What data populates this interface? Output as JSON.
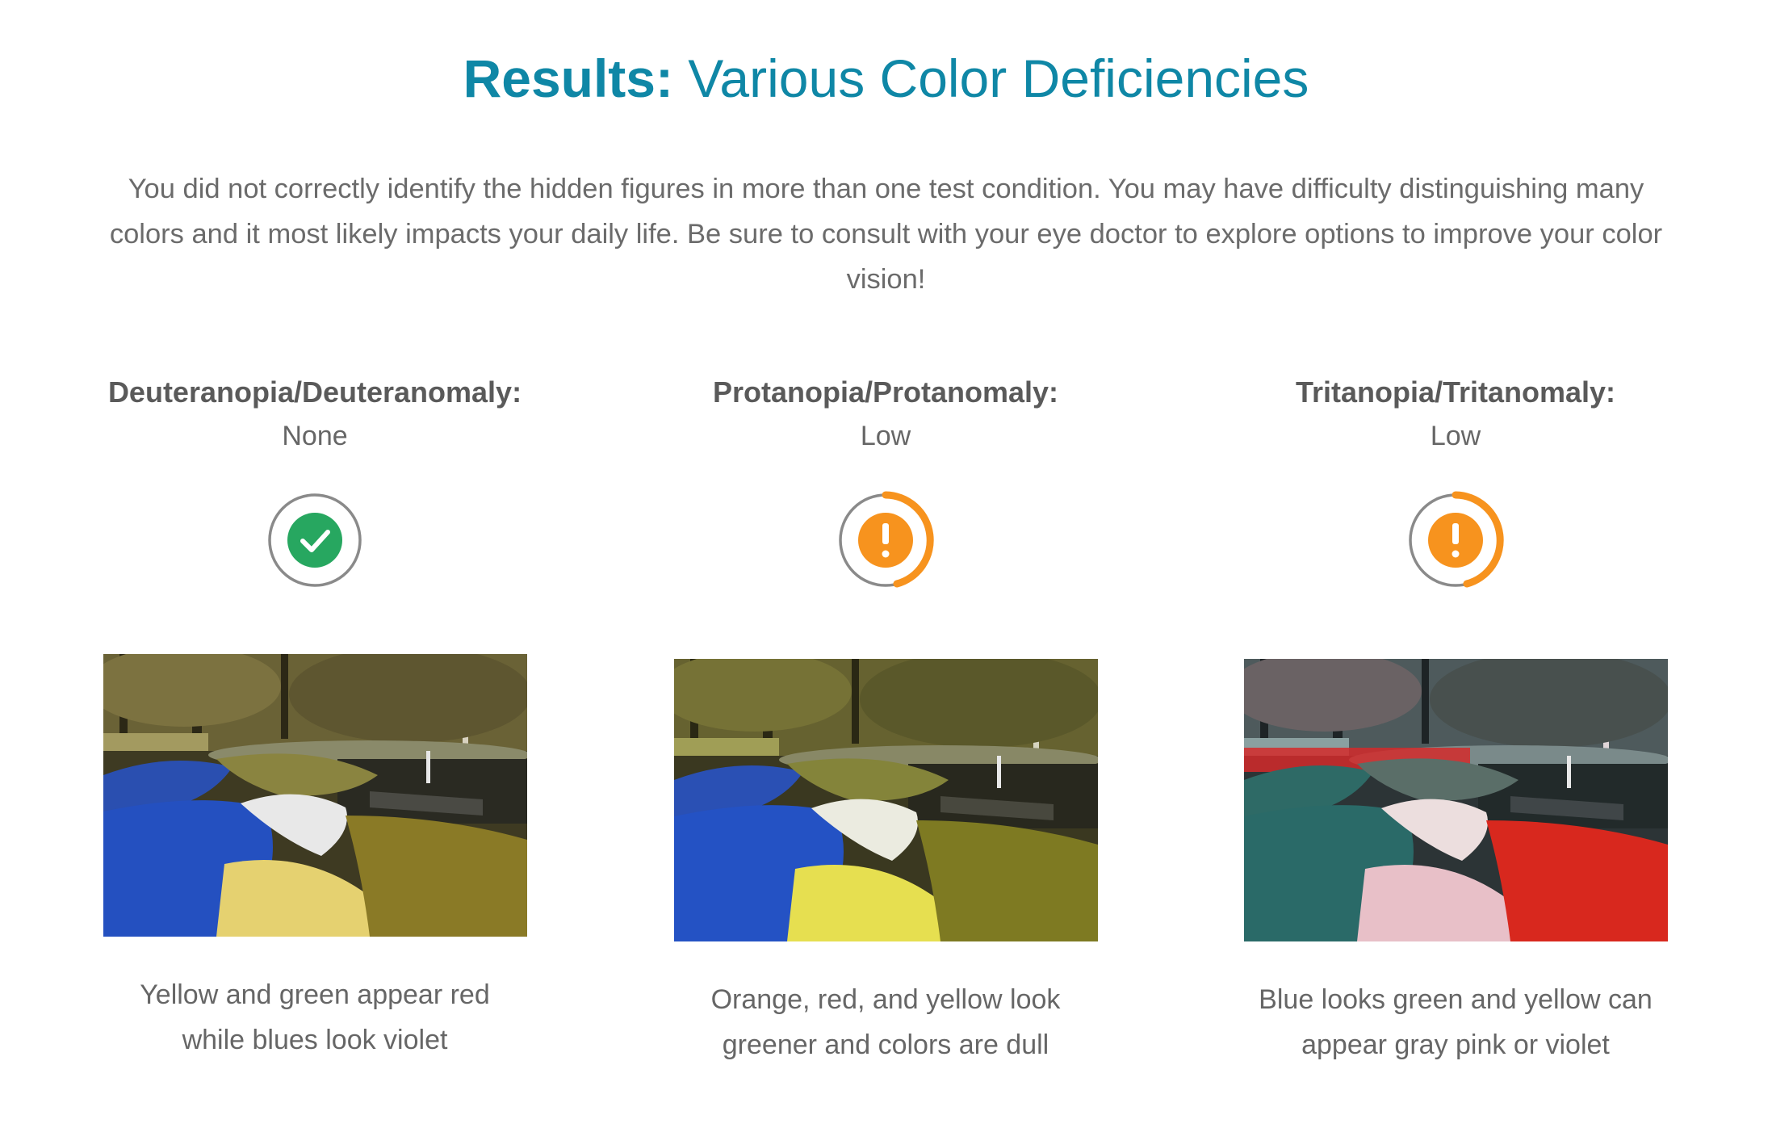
{
  "header": {
    "title_bold": "Results:",
    "title_rest": " Various Color Deficiencies"
  },
  "summary": "You did not correctly identify the hidden figures in more than one test condition. You may have difficulty distinguishing many colors and it most likely impacts your daily life. Be sure to consult with your eye doctor to explore options to improve your color vision!",
  "results": [
    {
      "title": "Deuteranopia/Deuteranomaly:",
      "level": "None",
      "icon": "check-circle-icon",
      "status_color": "#27a760",
      "caption": "Yellow and green appear red while blues look violet"
    },
    {
      "title": "Protanopia/Protanomaly:",
      "level": "Low",
      "icon": "warning-circle-icon",
      "status_color": "#f7931e",
      "caption": "Orange, red, and yellow look greener and colors are dull"
    },
    {
      "title": "Tritanopia/Tritanomaly:",
      "level": "Low",
      "icon": "warning-circle-icon",
      "status_color": "#f7931e",
      "caption": "Blue looks green and yellow can appear gray pink or violet"
    }
  ],
  "colors": {
    "accent": "#0f87a6",
    "text": "#5d5d5d",
    "ok": "#27a760",
    "warn": "#f7931e",
    "ring": "#8a8a8a"
  }
}
